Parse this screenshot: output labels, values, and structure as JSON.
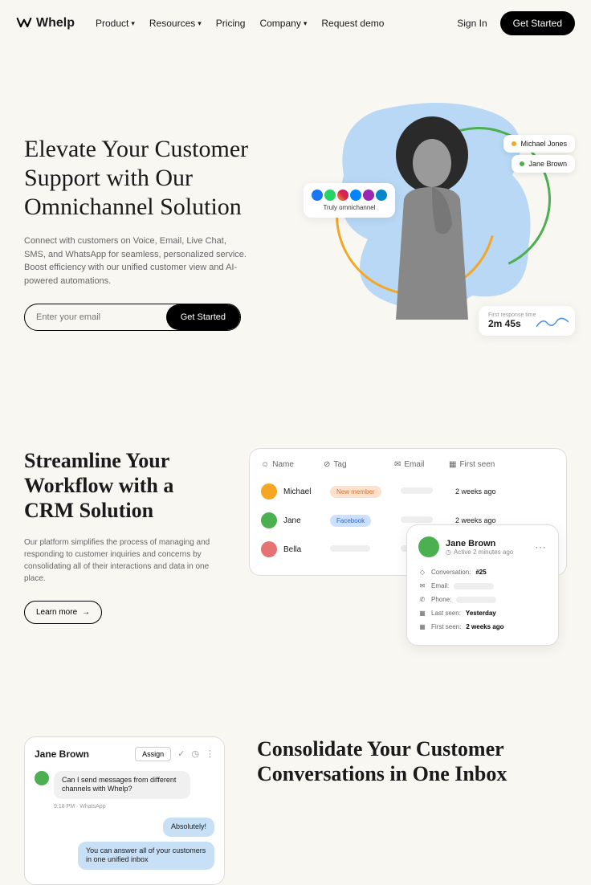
{
  "brand": "Whelp",
  "nav": {
    "product": "Product",
    "resources": "Resources",
    "pricing": "Pricing",
    "company": "Company",
    "demo": "Request demo"
  },
  "auth": {
    "signin": "Sign In",
    "getstarted": "Get Started"
  },
  "hero": {
    "title": "Elevate Your Customer Support with Our Omnichannel Solution",
    "sub": "Connect with customers on Voice, Email, Live Chat, SMS, and WhatsApp for seamless, personalized service. Boost efficiency with our unified customer view and AI-powered automations.",
    "placeholder": "Enter your email",
    "cta": "Get Started",
    "badges": {
      "person1": "Michael Jones",
      "person2": "Jane Brown",
      "omni": "Truly omnichannel",
      "response_label": "First response time",
      "response_value": "2m 45s"
    }
  },
  "crm": {
    "title": "Streamline Your Workflow with a CRM Solution",
    "sub": "Our platform simplifies the process of managing and responding to customer inquiries and concerns by consolidating all of their interactions and data in one place.",
    "learn": "Learn more",
    "columns": {
      "name": "Name",
      "tag": "Tag",
      "email": "Email",
      "seen": "First seen"
    },
    "rows": [
      {
        "name": "Michael",
        "tag": "New member",
        "tag_bg": "#ffe0cc",
        "tag_fg": "#cc7733",
        "avatar": "#f5a623",
        "seen": "2 weeks ago"
      },
      {
        "name": "Jane",
        "tag": "Facebook",
        "tag_bg": "#cce0ff",
        "tag_fg": "#3366cc",
        "avatar": "#4caf50",
        "seen": "2 weeks ago"
      },
      {
        "name": "Bella",
        "tag": "",
        "tag_bg": "",
        "tag_fg": "",
        "avatar": "#e57373",
        "seen": ""
      }
    ],
    "profile": {
      "name": "Jane Brown",
      "status": "Active 2 minutes ago",
      "conversation_label": "Conversation:",
      "conversation": "#25",
      "email_label": "Email:",
      "phone_label": "Phone:",
      "lastseen_label": "Last seen:",
      "lastseen": "Yesterday",
      "firstseen_label": "First seen:",
      "firstseen": "2 weeks ago"
    }
  },
  "inbox": {
    "chat": {
      "name": "Jane Brown",
      "assign": "Assign",
      "msg1": "Can I send messages from different channels with Whelp?",
      "meta": "9:18 PM · WhatsApp",
      "msg2": "Absolutely!",
      "msg3": "You can answer all of your customers in one unified inbox"
    },
    "title": "Consolidate Your Customer Conversations in One Inbox"
  }
}
